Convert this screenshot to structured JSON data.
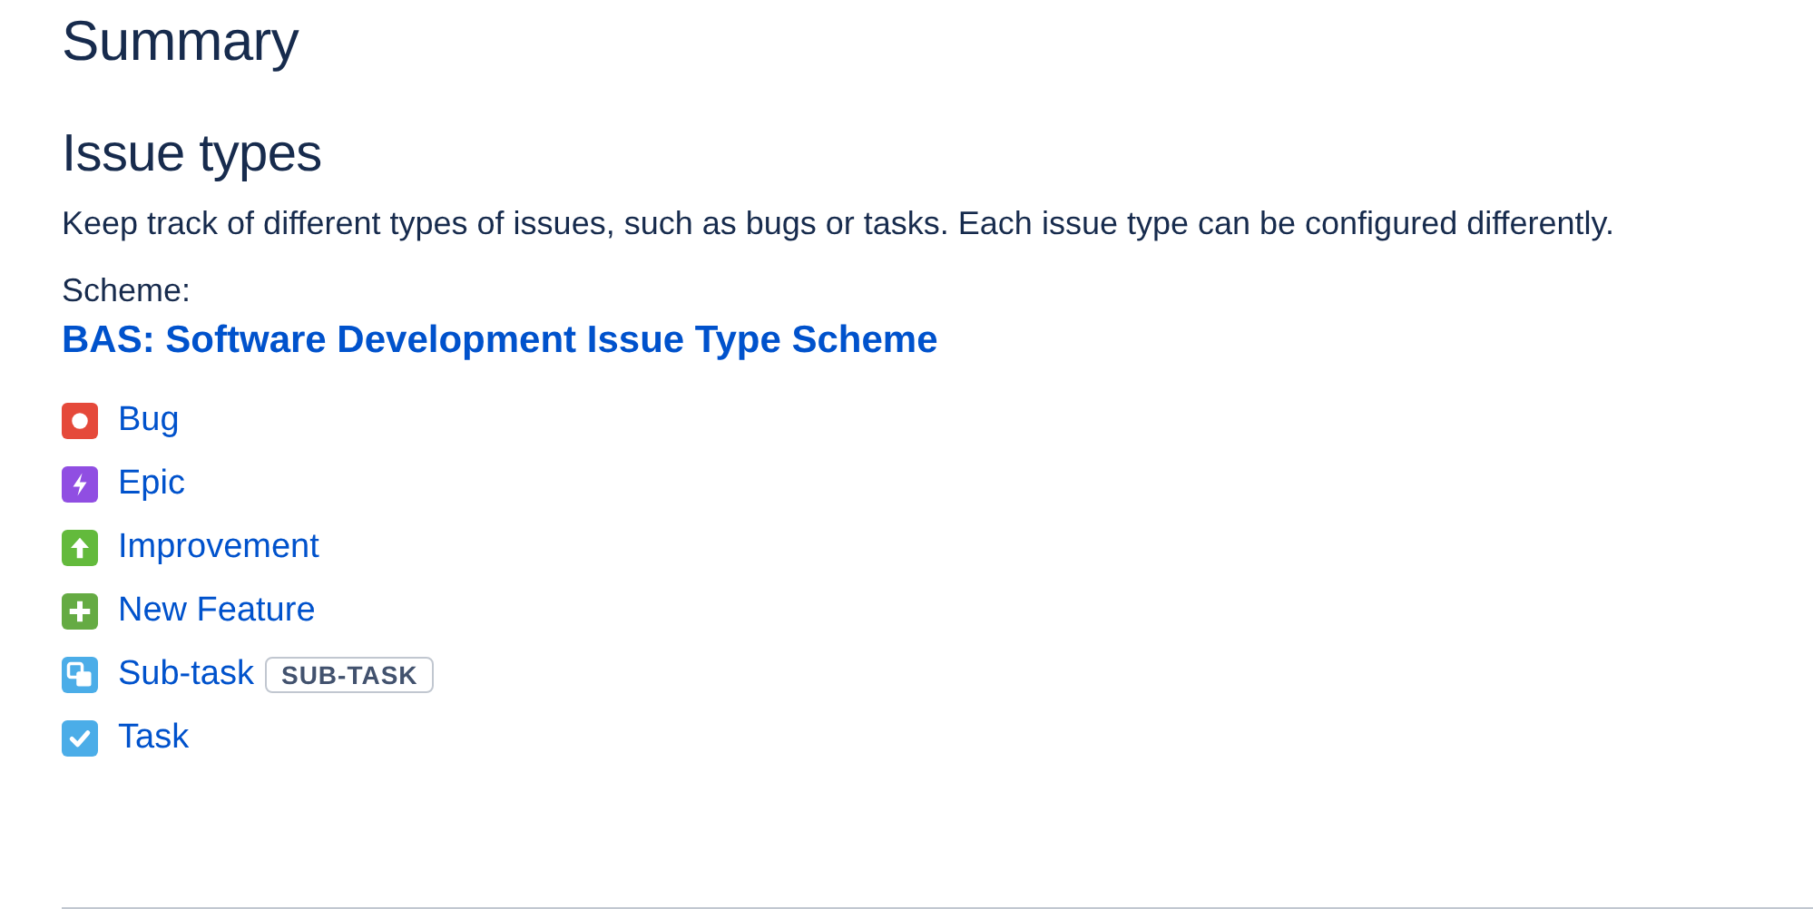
{
  "title": "Summary",
  "section": {
    "heading": "Issue types",
    "description": "Keep track of different types of issues, such as bugs or tasks. Each issue type can be configured differently.",
    "scheme_label": "Scheme:",
    "scheme_link": "BAS: Software Development Issue Type Scheme",
    "issue_types": [
      {
        "kind": "bug",
        "label": "Bug",
        "color": "#e5493a"
      },
      {
        "kind": "epic",
        "label": "Epic",
        "color": "#904ee2"
      },
      {
        "kind": "improvement",
        "label": "Improvement",
        "color": "#63ba3c"
      },
      {
        "kind": "feature",
        "label": "New Feature",
        "color": "#65ab43"
      },
      {
        "kind": "subtask",
        "label": "Sub-task",
        "color": "#4bade8",
        "badge": "SUB-TASK"
      },
      {
        "kind": "task",
        "label": "Task",
        "color": "#4bade8"
      }
    ]
  }
}
